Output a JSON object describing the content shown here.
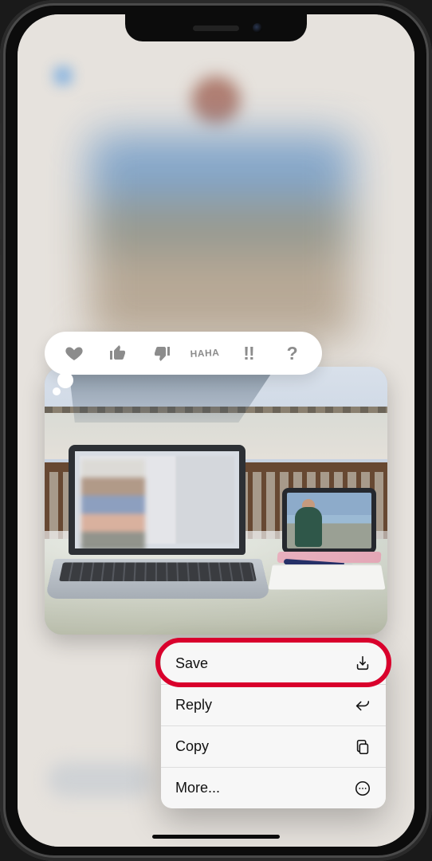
{
  "tapback": {
    "items": [
      {
        "name": "heart"
      },
      {
        "name": "thumbs-up"
      },
      {
        "name": "thumbs-down"
      },
      {
        "name": "haha",
        "label_top": "HA",
        "label_bottom": "HA"
      },
      {
        "name": "exclaim",
        "label": "!!"
      },
      {
        "name": "question",
        "label": "?"
      }
    ]
  },
  "context_menu": {
    "save": {
      "label": "Save",
      "highlighted": true
    },
    "reply": {
      "label": "Reply"
    },
    "copy": {
      "label": "Copy"
    },
    "more": {
      "label": "More..."
    }
  },
  "highlight_color": "#d9002c"
}
